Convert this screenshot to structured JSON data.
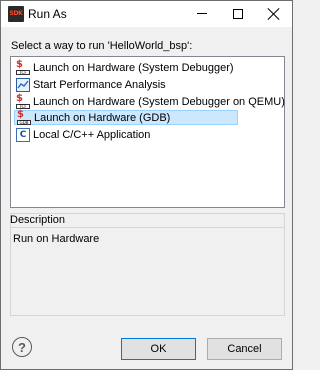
{
  "window": {
    "title": "Run As",
    "app_icon_text": "SDK"
  },
  "prompt": "Select a way to run 'HelloWorld_bsp':",
  "run_options": [
    {
      "label": "Launch on Hardware (System Debugger)",
      "icon": "tcf-debug-icon",
      "icon_caption": "TCF",
      "selected": false
    },
    {
      "label": "Start Performance Analysis",
      "icon": "performance-chart-icon",
      "selected": false
    },
    {
      "label": "Launch on Hardware (System Debugger on QEMU)",
      "icon": "tcf-debug-icon",
      "icon_caption": "TCF",
      "selected": false
    },
    {
      "label": "Launch on Hardware (GDB)",
      "icon": "gdb-debug-icon",
      "icon_caption": "GDB",
      "selected": true
    },
    {
      "label": "Local C/C++ Application",
      "icon": "c-application-icon",
      "icon_caption": "C",
      "selected": false
    }
  ],
  "description": {
    "title": "Description",
    "text": "Run on Hardware"
  },
  "buttons": {
    "help": "?",
    "ok": "OK",
    "cancel": "Cancel"
  },
  "colors": {
    "selection_bg": "#cce8ff",
    "selection_border": "#99d1ff",
    "default_button_border": "#0078d7"
  }
}
